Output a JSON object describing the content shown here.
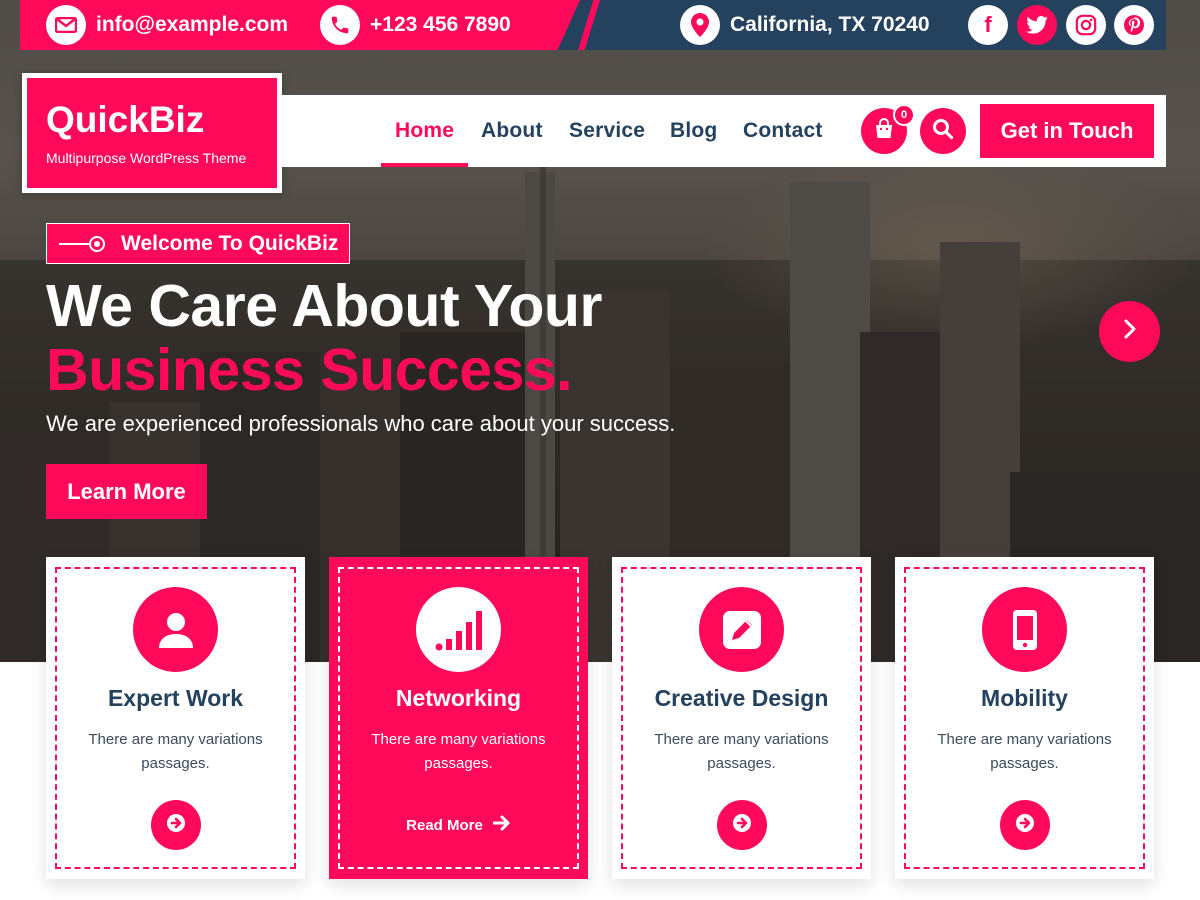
{
  "topbar": {
    "email": "info@example.com",
    "phone": "+123 456 7890",
    "location": "California, TX 70240",
    "social": [
      "facebook-icon",
      "twitter-icon",
      "instagram-icon",
      "pinterest-icon"
    ]
  },
  "brand": {
    "name": "QuickBiz",
    "tagline": "Multipurpose WordPress Theme"
  },
  "nav": {
    "items": [
      {
        "label": "Home",
        "active": true
      },
      {
        "label": "About"
      },
      {
        "label": "Service"
      },
      {
        "label": "Blog"
      },
      {
        "label": "Contact"
      }
    ],
    "cart_count": "0",
    "cta": "Get in Touch"
  },
  "hero": {
    "badge": "Welcome To QuickBiz",
    "title_line1": "We Care About Your",
    "title_line2": "Business Success.",
    "subtitle": "We are experienced professionals who care about your success.",
    "button": "Learn More"
  },
  "cards": [
    {
      "icon": "user-icon",
      "title": "Expert Work",
      "desc": "There are many variations passages."
    },
    {
      "icon": "signal-bars-icon",
      "title": "Networking",
      "desc": "There are many variations passages.",
      "link": "Read More"
    },
    {
      "icon": "pencil-square-icon",
      "title": "Creative Design",
      "desc": "There are many variations passages."
    },
    {
      "icon": "mobile-phone-icon",
      "title": "Mobility",
      "desc": "There are many variations passages."
    }
  ],
  "colors": {
    "accent": "#ff0a5a",
    "navy": "#24415e",
    "white": "#ffffff"
  }
}
